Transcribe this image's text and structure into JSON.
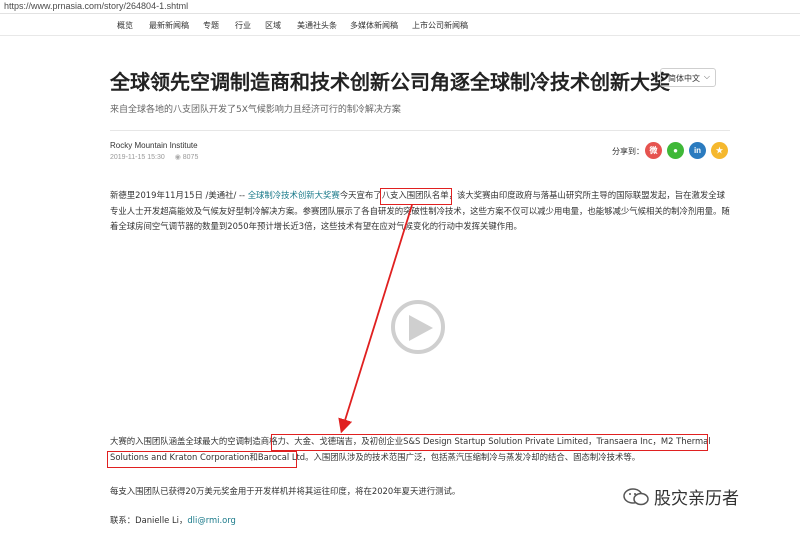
{
  "browser": {
    "url": "https://www.prnasia.com/story/264804-1.shtml"
  },
  "nav": {
    "items": [
      "概览",
      "最新新闻稿",
      "专题",
      "行业",
      "区域",
      "美通社头条",
      "多媒体新闻稿",
      "上市公司新闻稿"
    ]
  },
  "article": {
    "title": "全球领先空调制造商和技术创新公司角逐全球制冷技术创新大奖",
    "subtitle": "来自全球各地的八支团队开发了5X气候影响力且经济可行的制冷解决方案",
    "author": "Rocky Mountain Institute",
    "date": "2019-11-15 15:30",
    "views": "8075"
  },
  "language": {
    "selected": "简体中文"
  },
  "share": {
    "label": "分享到：",
    "buttons": [
      "weibo-icon",
      "wechat-icon",
      "linkedin-icon",
      "favorite-icon"
    ]
  },
  "body": {
    "p1_a": "新德里2019年11月15日 /美通社/ -- ",
    "p1_link": "全球制冷技术创新大奖赛",
    "p1_b": "今天宣布了",
    "p1_highlight": "八支入围团队名单",
    "p1_c": "，该大奖赛由印度政府与落基山研究所主导的国际联盟发起，旨在激发全球专业人士开发超高能效及气候友好型制冷解决方案。参赛团队展示了各自研发的突破性制冷技术，这些方案不仅可以减少用电量，也能够减少气候相关的制冷剂用量。随着全球房间空气调节器的数量到2050年预计增长近3倍，这些技术有望在应对气候变化的行动中发挥关键作用。",
    "p2_a": "大赛的入围团队涵盖全球最大的空调制造商",
    "p2_highlight": "格力、大金、戈德瑞吉，及初创企业S&S Design Startup Solution Private Limited，Transaera Inc，M2 Thermal Solutions and Kraton Corporation和Barocal Ltd。",
    "p2_b": "入围团队涉及的技术范围广泛，包括蒸汽压缩制冷与蒸发冷却的结合、固态制冷技术等。",
    "p3": "每支入围团队已获得20万美元奖金用于开发样机并将其运往印度，将在2020年夏天进行测试。",
    "p4_label": "联系：Danielle Li，",
    "p4_email": "dli@rmi.org"
  },
  "watermark": {
    "text": "股灾亲历者"
  },
  "colors": {
    "annotation": "#e02020",
    "link": "#1a7a8a",
    "weibo": "#e6534f",
    "wechat": "#3fb838",
    "linkedin": "#2b7bbf",
    "favorite": "#f5b82e"
  }
}
